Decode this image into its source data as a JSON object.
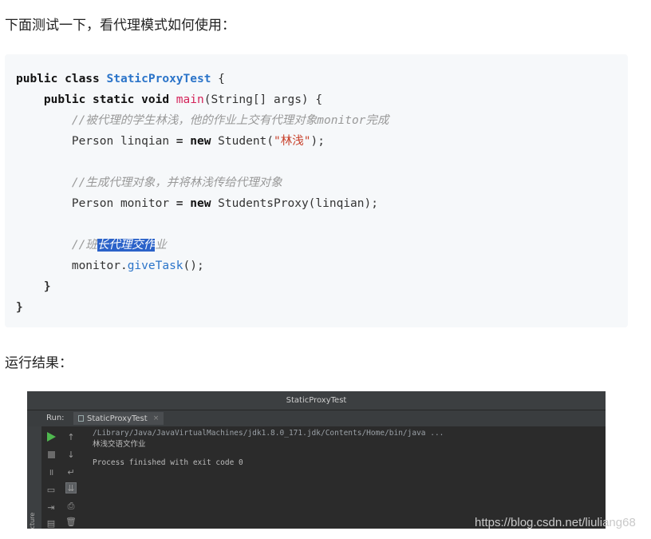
{
  "intro_text": "下面测试一下，看代理模式如何使用：",
  "code": {
    "line1": {
      "kw": "public class ",
      "cls": "StaticProxyTest",
      "rest": " {"
    },
    "line2": {
      "kw": "public static void ",
      "method": "main",
      "args": "(String[] args) {"
    },
    "line3": {
      "comment": "//被代理的学生林浅，他的作业上交有代理对象monitor完成"
    },
    "line4": {
      "pre": "Person linqian ",
      "op": "=",
      "new_kw": " new",
      "mid": " Student(",
      "string": "\"林浅\"",
      "end": ");"
    },
    "line5": {
      "comment": "//生成代理对象，并将林浅传给代理对象"
    },
    "line6": {
      "pre": "Person monitor ",
      "op": "=",
      "new_kw": " new",
      "rest": " StudentsProxy(linqian);"
    },
    "line7": {
      "comment_a": "//班",
      "comment_sel": "长代理交作",
      "comment_b": "业"
    },
    "line8": {
      "obj": "monitor.",
      "fn": "giveTask",
      "rest": "();"
    },
    "line9": "}",
    "line10": "}"
  },
  "result_label": "运行结果：",
  "ide": {
    "window_title": "StaticProxyTest",
    "run_label": "Run:",
    "tab_title": "StaticProxyTest",
    "tab_close": "×",
    "structure_label": "Structure",
    "console": {
      "line1": "/Library/Java/JavaVirtualMachines/jdk1.8.0_171.jdk/Contents/Home/bin/java ...",
      "line2": "林浅交语文作业",
      "line3": "",
      "line4": "Process finished with exit code 0"
    },
    "icons": {
      "run": "play-icon",
      "stop": "stop-icon",
      "pause": "pause-icon",
      "scroll_up": "arrow-up-icon",
      "scroll_down": "arrow-down-icon",
      "wrap": "soft-wrap-icon",
      "print": "print-icon",
      "delete": "trash-icon"
    }
  },
  "watermark": "https://blog.csdn.net/liuliang68"
}
